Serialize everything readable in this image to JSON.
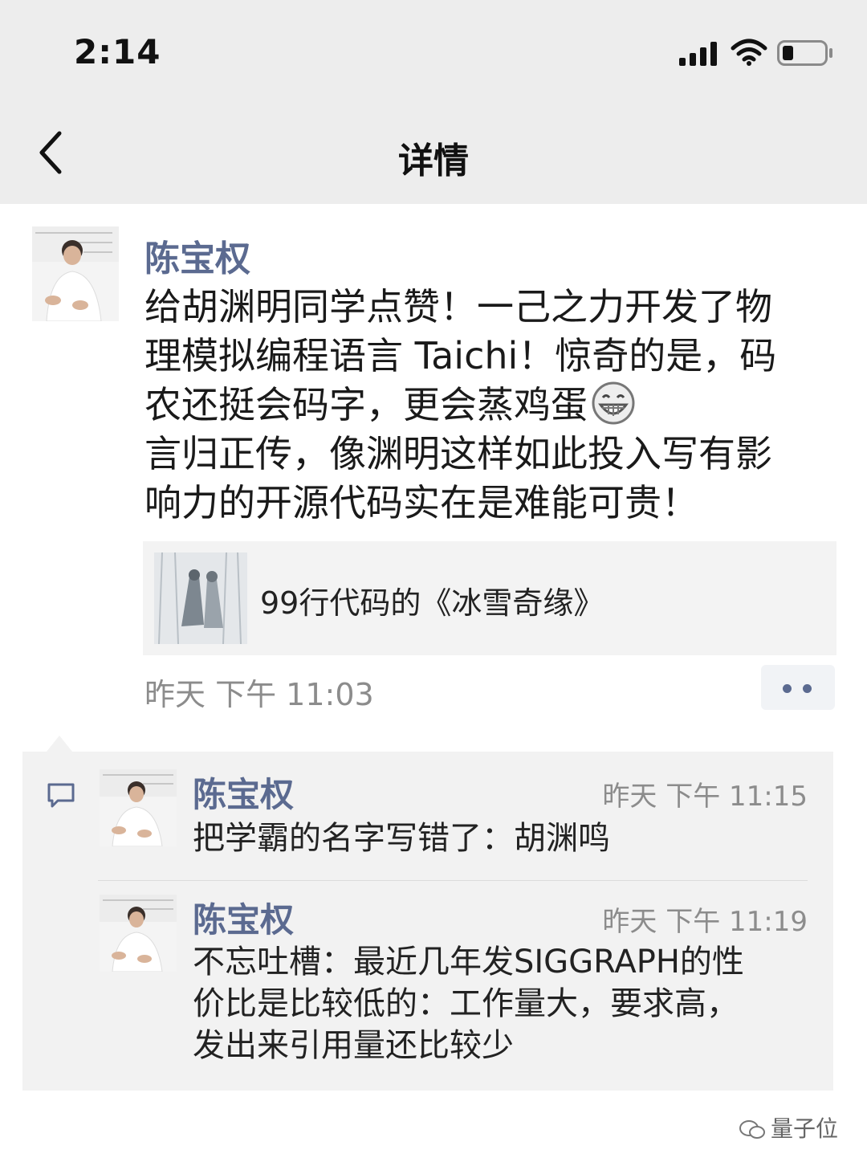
{
  "status_bar": {
    "time": "2:14"
  },
  "nav": {
    "title": "详情"
  },
  "post": {
    "author": "陈宝权",
    "text_lines": [
      "给胡渊明同学点赞！一己之力开发了物",
      "理模拟编程语言 Taichi！惊奇的是，码",
      "农还挺会码字，更会蒸鸡蛋",
      "言归正传，像渊明这样如此投入写有影",
      "响力的开源代码实在是难能可贵！"
    ],
    "emoji": "grinning-face-icon",
    "link_title": "99行代码的《冰雪奇缘》",
    "time": "昨天  下午 11:03"
  },
  "comments": [
    {
      "name": "陈宝权",
      "time": "昨天 下午 11:15",
      "lines": [
        "把学霸的名字写错了：胡渊鸣"
      ]
    },
    {
      "name": "陈宝权",
      "time": "昨天 下午 11:19",
      "lines": [
        "不忘吐槽：最近几年发SIGGRAPH的性",
        "价比是比较低的：工作量大，要求高，",
        "发出来引用量还比较少"
      ]
    }
  ],
  "watermark": "量子位",
  "colors": {
    "name_link": "#5b6a90",
    "header_bg": "#ededed",
    "comment_bg": "#f2f2f2"
  }
}
